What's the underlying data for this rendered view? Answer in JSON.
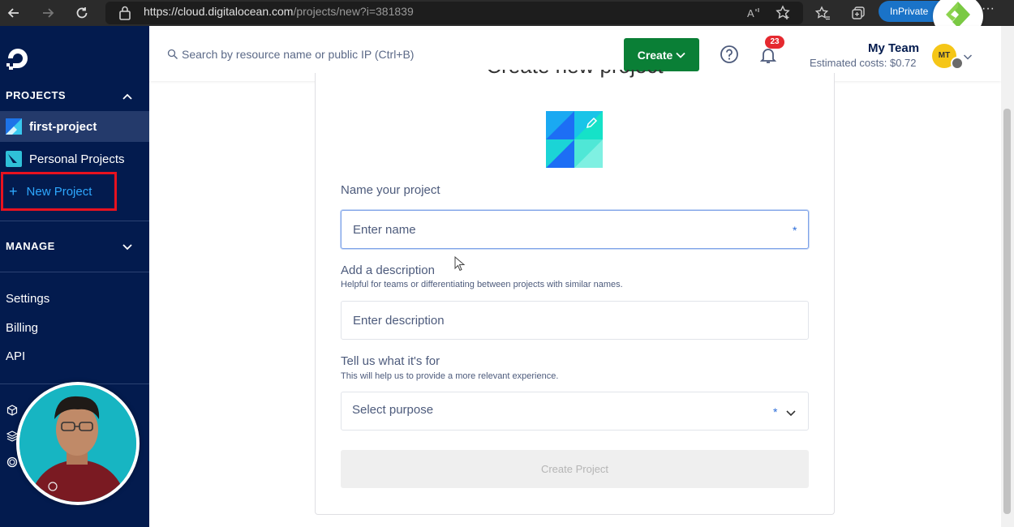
{
  "browser": {
    "url_domain": "https://cloud.digitalocean.com",
    "url_path": "/projects/new?i=381839",
    "inprivate_label": "InPrivate",
    "icons": [
      "back-icon",
      "forward-icon",
      "refresh-icon",
      "lock-icon",
      "read-aloud-icon",
      "favorite-icon",
      "favorites-icon",
      "collections-icon",
      "more-icon"
    ]
  },
  "sidebar": {
    "projects_heading": "PROJECTS",
    "projects": [
      {
        "label": "first-project",
        "active": true
      },
      {
        "label": "Personal Projects",
        "active": false
      }
    ],
    "new_project_label": "New Project",
    "manage_heading": "MANAGE",
    "links": [
      "Settings",
      "Billing",
      "API"
    ]
  },
  "topbar": {
    "search_placeholder": "Search by resource name or public IP (Ctrl+B)",
    "create_label": "Create",
    "notification_count": "23",
    "team_name": "My Team",
    "estimated_costs": "Estimated costs: $0.72",
    "avatar_initials": "MT"
  },
  "form": {
    "title": "Create new project",
    "name_label": "Name your project",
    "name_placeholder": "Enter name",
    "description_label": "Add a description",
    "description_help": "Helpful for teams or differentiating between projects with similar names.",
    "description_placeholder": "Enter description",
    "purpose_label": "Tell us what it's for",
    "purpose_help": "This will help us to provide a more relevant experience.",
    "purpose_value": "Select purpose",
    "required_mark": "*",
    "submit_label": "Create Project"
  },
  "colors": {
    "sidebar_bg": "#031b4e",
    "accent_blue": "#2ea8ff",
    "create_green": "#0a7f36",
    "highlight_red": "#e8121f",
    "badge_red": "#e5292f"
  }
}
